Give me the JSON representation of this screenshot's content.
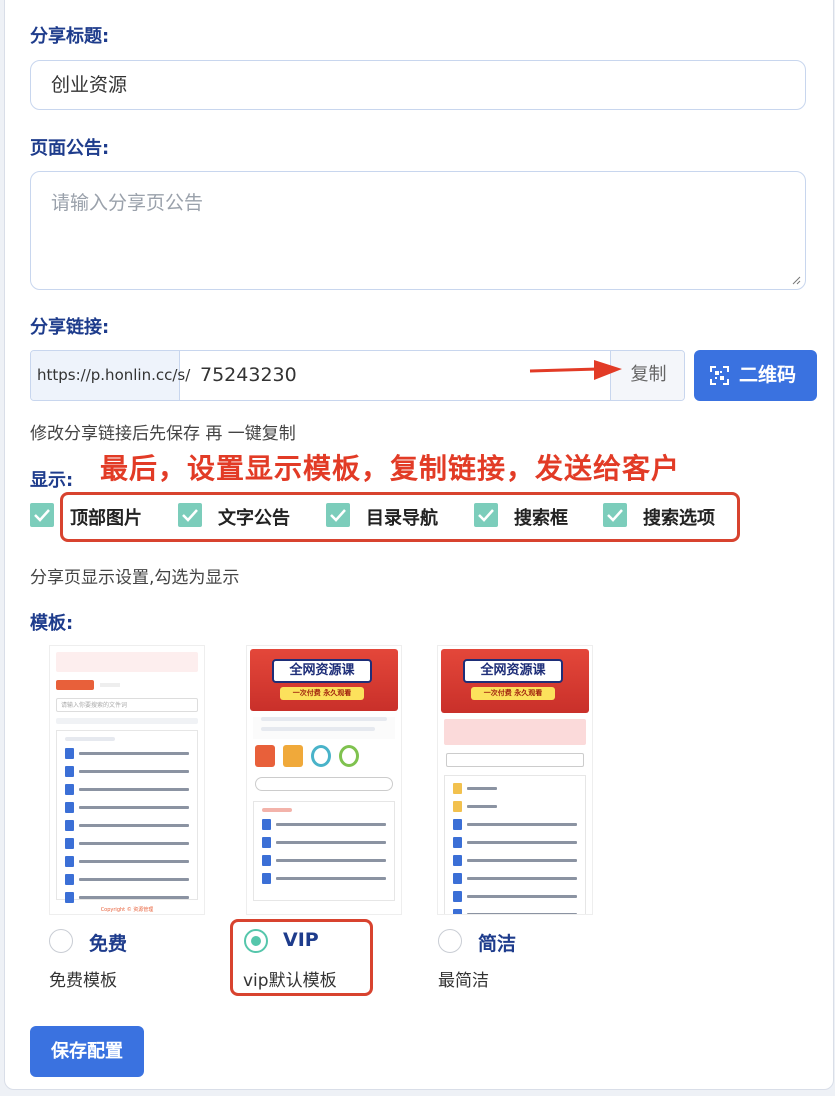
{
  "share_title": {
    "label": "分享标题:",
    "value": "创业资源"
  },
  "notice": {
    "label": "页面公告:",
    "placeholder": "请输入分享页公告"
  },
  "share_link": {
    "label": "分享链接:",
    "prefix": "https://p.honlin.cc/s/",
    "value": "75243230",
    "copy_label": "复制",
    "qrcode_label": "二维码",
    "hint": "修改分享链接后先保存 再 一键复制"
  },
  "annotation": "最后，设置显示模板，复制链接，发送给客户",
  "display": {
    "label": "显示:",
    "options": [
      {
        "label": "顶部图片",
        "checked": true
      },
      {
        "label": "文字公告",
        "checked": true
      },
      {
        "label": "目录导航",
        "checked": true
      },
      {
        "label": "搜索框",
        "checked": true
      },
      {
        "label": "搜索选项",
        "checked": true
      }
    ],
    "hint": "分享页显示设置,勾选为显示"
  },
  "templates": {
    "label": "模板:",
    "items": [
      {
        "name": "免费",
        "desc": "免费模板",
        "selected": false
      },
      {
        "name": "VIP",
        "desc": "vip默认模板",
        "selected": true
      },
      {
        "name": "简洁",
        "desc": "最简洁",
        "selected": false
      }
    ],
    "thumb_text": {
      "banner_title": "全网资源课",
      "banner_sub": "一次付费 永久观看",
      "search_placeholder": "请输入你要搜索的文件词",
      "copyright": "Copyright © 资源管理"
    }
  },
  "save_label": "保存配置",
  "colors": {
    "primary": "#3a72e0",
    "label": "#1e3c8c",
    "check": "#7ccdbb",
    "annotation": "#e23b26"
  }
}
